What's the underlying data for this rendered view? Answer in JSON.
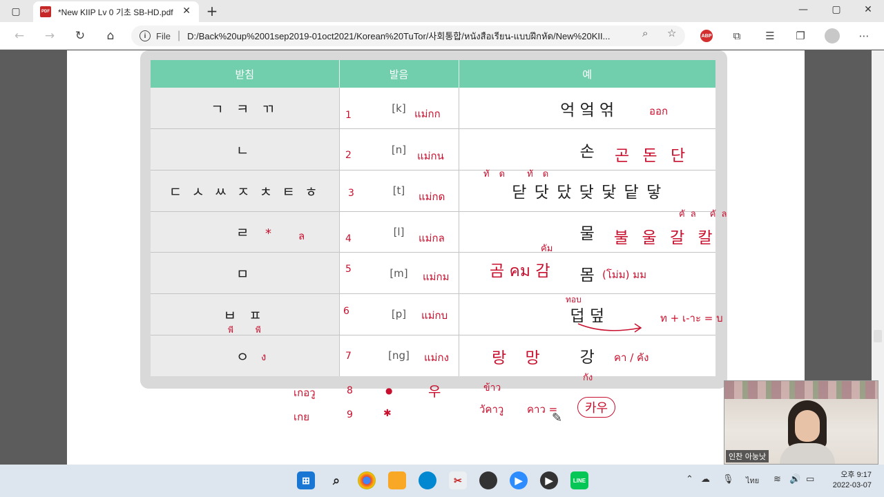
{
  "browser": {
    "tab_title": "*New KIIP Lv 0 기초 SB-HD.pdf",
    "address_prefix": "File",
    "url": "D:/Back%20up%2001sep2019-01oct2021/Korean%20TuTor/사회통합/หนังสือเรียน-แบบฝึกหัด/New%20KII...",
    "pdf_label": "PDF",
    "abp_label": "ABP"
  },
  "table": {
    "headers": [
      "받침",
      "발음",
      "예"
    ],
    "rows": [
      {
        "final": "ㄱ ㅋ ㄲ",
        "pron": "[k]",
        "example": "억 엌 얶"
      },
      {
        "final": "ㄴ",
        "pron": "[n]",
        "example": "손"
      },
      {
        "final": "ㄷ ㅅ ㅆ ㅈ ㅊ ㅌ ㅎ",
        "pron": "[t]",
        "example": "닫 닷 닸 닺 닻 닽 닿"
      },
      {
        "final": "ㄹ",
        "pron": "[l]",
        "example": "물"
      },
      {
        "final": "ㅁ",
        "pron": "[m]",
        "example": "몸"
      },
      {
        "final": "ㅂ ㅍ",
        "pron": "[p]",
        "example": "덥 덮"
      },
      {
        "final": "ㅇ",
        "pron": "[ng]",
        "example": "강"
      }
    ]
  },
  "annotations": {
    "nums": [
      "1",
      "2",
      "3",
      "4",
      "5",
      "6",
      "7",
      "8",
      "9"
    ],
    "maekot": [
      "แม่กก",
      "แม่กน",
      "แม่กด",
      "แม่กล",
      "แม่กม",
      "แม่กบ",
      "แม่กง"
    ],
    "row1_thai": "ออก",
    "row2_extra": "곤 돈 단",
    "row3_top": "ทัด ทัด",
    "row4_star": "*",
    "row4_thai": "ล",
    "row4_extra": "불 울 갈 칼",
    "row4_top": "คัล คัล",
    "row5_left": "곰 คม 감",
    "row5_top": "คัม",
    "row5_right": "(โม่ม) มม",
    "row6_top": "ทอบ",
    "row6_right": "ท + เ-าะ = บ",
    "row6_below": "พี พี",
    "row7_final_thai": "ง",
    "row7_left": "랑 망",
    "row7_right": "คา / คัง",
    "row7_below": "กัง",
    "bottom_1": "เกอวู",
    "bottom_2": "เกย",
    "bottom_u": "우",
    "bottom_khao": "ข้าว",
    "bottom_kau": "วัคาวู",
    "bottom_kaw": "คาว =",
    "bottom_circled": "카우"
  },
  "webcam": {
    "label": "인찬 아눙낫"
  },
  "taskbar": {
    "lang": "ไทย",
    "time": "오후 9:17",
    "date": "2022-03-07"
  }
}
